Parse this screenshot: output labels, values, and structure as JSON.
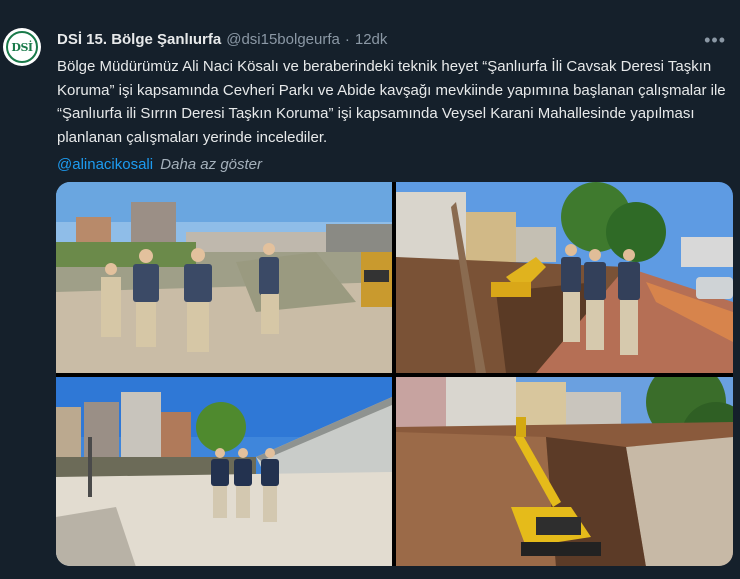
{
  "tweet": {
    "display_name": "DSİ 15. Bölge Şanlıurfa",
    "handle": "@dsi15bolgeurfa",
    "separator": "·",
    "time": "12dk",
    "more_icon": "more-horizontal-icon",
    "body": "Bölge Müdürümüz Ali Naci Kösalı ve beraberindeki teknik heyet “Şanlıurfa İli Cavsak Deresi Taşkın Koruma” işi kapsamında Cevheri Parkı ve Abide kavşağı mevkiinde yapımına başlanan çalışmalar ile “Şanlıurfa ili Sırrın Deresi Taşkın Koruma” işi kapsamında Veysel Karani Mahallesinde yapılması planlanan çalışmaları yerinde incelediler.",
    "mention": "@alinacikosali",
    "show_less": "Daha az göster",
    "avatar_text": "DSİ"
  },
  "colors": {
    "background": "#15202b",
    "text": "#e7e9ea",
    "secondary": "#8b98a5",
    "link": "#1d9bf0"
  }
}
